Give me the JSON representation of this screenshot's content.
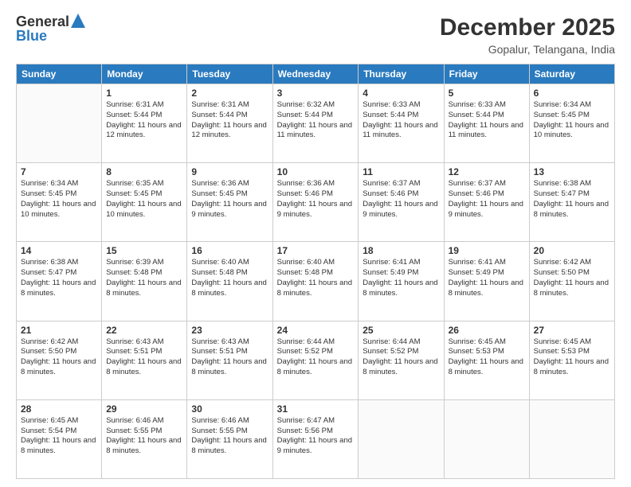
{
  "logo": {
    "general": "General",
    "blue": "Blue"
  },
  "header": {
    "month": "December 2025",
    "location": "Gopalur, Telangana, India"
  },
  "days": [
    "Sunday",
    "Monday",
    "Tuesday",
    "Wednesday",
    "Thursday",
    "Friday",
    "Saturday"
  ],
  "weeks": [
    [
      {
        "day": "",
        "sunrise": "",
        "sunset": "",
        "daylight": ""
      },
      {
        "day": "1",
        "sunrise": "Sunrise: 6:31 AM",
        "sunset": "Sunset: 5:44 PM",
        "daylight": "Daylight: 11 hours and 12 minutes."
      },
      {
        "day": "2",
        "sunrise": "Sunrise: 6:31 AM",
        "sunset": "Sunset: 5:44 PM",
        "daylight": "Daylight: 11 hours and 12 minutes."
      },
      {
        "day": "3",
        "sunrise": "Sunrise: 6:32 AM",
        "sunset": "Sunset: 5:44 PM",
        "daylight": "Daylight: 11 hours and 11 minutes."
      },
      {
        "day": "4",
        "sunrise": "Sunrise: 6:33 AM",
        "sunset": "Sunset: 5:44 PM",
        "daylight": "Daylight: 11 hours and 11 minutes."
      },
      {
        "day": "5",
        "sunrise": "Sunrise: 6:33 AM",
        "sunset": "Sunset: 5:44 PM",
        "daylight": "Daylight: 11 hours and 11 minutes."
      },
      {
        "day": "6",
        "sunrise": "Sunrise: 6:34 AM",
        "sunset": "Sunset: 5:45 PM",
        "daylight": "Daylight: 11 hours and 10 minutes."
      }
    ],
    [
      {
        "day": "7",
        "sunrise": "Sunrise: 6:34 AM",
        "sunset": "Sunset: 5:45 PM",
        "daylight": "Daylight: 11 hours and 10 minutes."
      },
      {
        "day": "8",
        "sunrise": "Sunrise: 6:35 AM",
        "sunset": "Sunset: 5:45 PM",
        "daylight": "Daylight: 11 hours and 10 minutes."
      },
      {
        "day": "9",
        "sunrise": "Sunrise: 6:36 AM",
        "sunset": "Sunset: 5:45 PM",
        "daylight": "Daylight: 11 hours and 9 minutes."
      },
      {
        "day": "10",
        "sunrise": "Sunrise: 6:36 AM",
        "sunset": "Sunset: 5:46 PM",
        "daylight": "Daylight: 11 hours and 9 minutes."
      },
      {
        "day": "11",
        "sunrise": "Sunrise: 6:37 AM",
        "sunset": "Sunset: 5:46 PM",
        "daylight": "Daylight: 11 hours and 9 minutes."
      },
      {
        "day": "12",
        "sunrise": "Sunrise: 6:37 AM",
        "sunset": "Sunset: 5:46 PM",
        "daylight": "Daylight: 11 hours and 9 minutes."
      },
      {
        "day": "13",
        "sunrise": "Sunrise: 6:38 AM",
        "sunset": "Sunset: 5:47 PM",
        "daylight": "Daylight: 11 hours and 8 minutes."
      }
    ],
    [
      {
        "day": "14",
        "sunrise": "Sunrise: 6:38 AM",
        "sunset": "Sunset: 5:47 PM",
        "daylight": "Daylight: 11 hours and 8 minutes."
      },
      {
        "day": "15",
        "sunrise": "Sunrise: 6:39 AM",
        "sunset": "Sunset: 5:48 PM",
        "daylight": "Daylight: 11 hours and 8 minutes."
      },
      {
        "day": "16",
        "sunrise": "Sunrise: 6:40 AM",
        "sunset": "Sunset: 5:48 PM",
        "daylight": "Daylight: 11 hours and 8 minutes."
      },
      {
        "day": "17",
        "sunrise": "Sunrise: 6:40 AM",
        "sunset": "Sunset: 5:48 PM",
        "daylight": "Daylight: 11 hours and 8 minutes."
      },
      {
        "day": "18",
        "sunrise": "Sunrise: 6:41 AM",
        "sunset": "Sunset: 5:49 PM",
        "daylight": "Daylight: 11 hours and 8 minutes."
      },
      {
        "day": "19",
        "sunrise": "Sunrise: 6:41 AM",
        "sunset": "Sunset: 5:49 PM",
        "daylight": "Daylight: 11 hours and 8 minutes."
      },
      {
        "day": "20",
        "sunrise": "Sunrise: 6:42 AM",
        "sunset": "Sunset: 5:50 PM",
        "daylight": "Daylight: 11 hours and 8 minutes."
      }
    ],
    [
      {
        "day": "21",
        "sunrise": "Sunrise: 6:42 AM",
        "sunset": "Sunset: 5:50 PM",
        "daylight": "Daylight: 11 hours and 8 minutes."
      },
      {
        "day": "22",
        "sunrise": "Sunrise: 6:43 AM",
        "sunset": "Sunset: 5:51 PM",
        "daylight": "Daylight: 11 hours and 8 minutes."
      },
      {
        "day": "23",
        "sunrise": "Sunrise: 6:43 AM",
        "sunset": "Sunset: 5:51 PM",
        "daylight": "Daylight: 11 hours and 8 minutes."
      },
      {
        "day": "24",
        "sunrise": "Sunrise: 6:44 AM",
        "sunset": "Sunset: 5:52 PM",
        "daylight": "Daylight: 11 hours and 8 minutes."
      },
      {
        "day": "25",
        "sunrise": "Sunrise: 6:44 AM",
        "sunset": "Sunset: 5:52 PM",
        "daylight": "Daylight: 11 hours and 8 minutes."
      },
      {
        "day": "26",
        "sunrise": "Sunrise: 6:45 AM",
        "sunset": "Sunset: 5:53 PM",
        "daylight": "Daylight: 11 hours and 8 minutes."
      },
      {
        "day": "27",
        "sunrise": "Sunrise: 6:45 AM",
        "sunset": "Sunset: 5:53 PM",
        "daylight": "Daylight: 11 hours and 8 minutes."
      }
    ],
    [
      {
        "day": "28",
        "sunrise": "Sunrise: 6:45 AM",
        "sunset": "Sunset: 5:54 PM",
        "daylight": "Daylight: 11 hours and 8 minutes."
      },
      {
        "day": "29",
        "sunrise": "Sunrise: 6:46 AM",
        "sunset": "Sunset: 5:55 PM",
        "daylight": "Daylight: 11 hours and 8 minutes."
      },
      {
        "day": "30",
        "sunrise": "Sunrise: 6:46 AM",
        "sunset": "Sunset: 5:55 PM",
        "daylight": "Daylight: 11 hours and 8 minutes."
      },
      {
        "day": "31",
        "sunrise": "Sunrise: 6:47 AM",
        "sunset": "Sunset: 5:56 PM",
        "daylight": "Daylight: 11 hours and 9 minutes."
      },
      {
        "day": "",
        "sunrise": "",
        "sunset": "",
        "daylight": ""
      },
      {
        "day": "",
        "sunrise": "",
        "sunset": "",
        "daylight": ""
      },
      {
        "day": "",
        "sunrise": "",
        "sunset": "",
        "daylight": ""
      }
    ]
  ]
}
